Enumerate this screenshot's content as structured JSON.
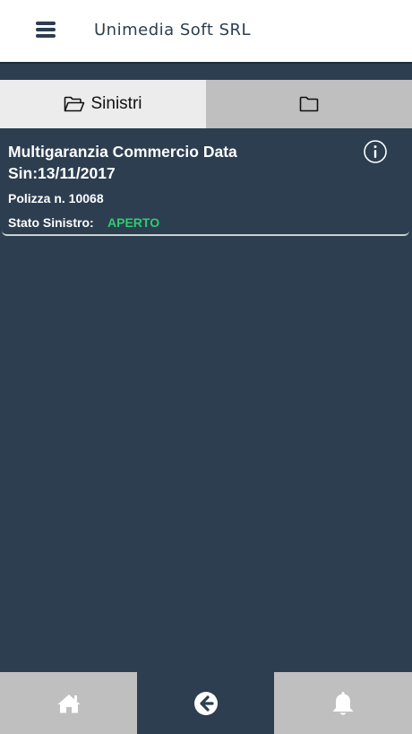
{
  "header": {
    "title": "Unimedia Soft SRL",
    "menu_icon": "hamburger-menu-icon"
  },
  "tabs": [
    {
      "label": "Sinistri",
      "icon": "folder-open-icon",
      "active": true
    },
    {
      "label": "",
      "icon": "folder-icon",
      "active": false
    }
  ],
  "claim": {
    "title_line1": "Multigaranzia Commercio Data",
    "title_line2": "Sin:13/11/2017",
    "policy": "Polizza n. 10068",
    "status_label": "Stato Sinistro:",
    "status_value": "APERTO",
    "info_icon": "info-icon"
  },
  "bottom_nav": [
    {
      "icon": "home-icon"
    },
    {
      "icon": "back-arrow-icon"
    },
    {
      "icon": "bell-icon"
    }
  ],
  "colors": {
    "background": "#2c3e50",
    "header_bg": "#ffffff",
    "tab_active": "#ececec",
    "tab_inactive": "#bfbfbf",
    "status_open": "#2ecc71"
  }
}
